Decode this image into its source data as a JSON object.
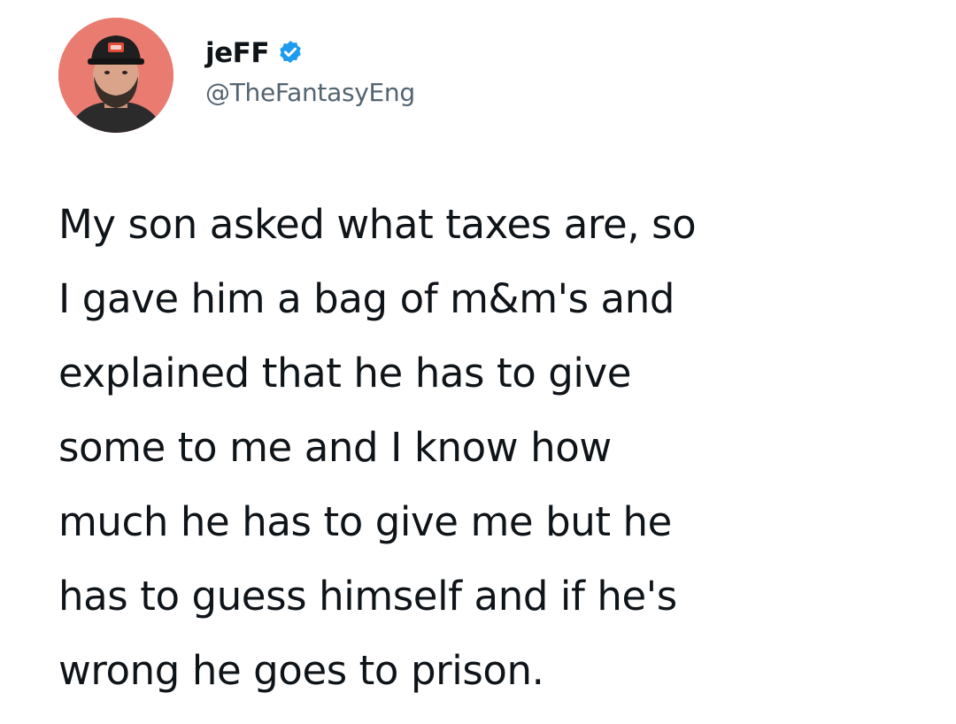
{
  "tweet": {
    "author": {
      "display_name": "jeFF",
      "handle": "@TheFantasyEng",
      "verified": true,
      "avatar_icon": "profile-photo-man-with-cap",
      "verified_icon": "verified-badge-icon",
      "verified_color": "#1d9bf0"
    },
    "text_lines": [
      "My son asked what taxes are, so",
      "I gave him a bag of m&m's and",
      "explained that he has to give",
      "some to me and I know how",
      "much he has to give me but he",
      "has to guess himself and if he's",
      "wrong he goes to prison."
    ]
  }
}
